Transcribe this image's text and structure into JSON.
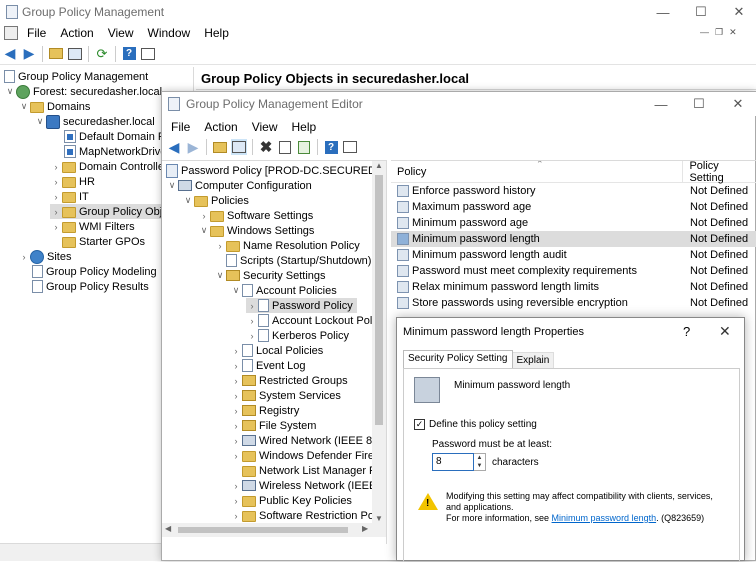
{
  "gpm": {
    "title": "Group Policy Management",
    "menu": [
      "File",
      "Action",
      "View",
      "Window",
      "Help"
    ],
    "tree": [
      {
        "label": "Group Policy Management",
        "icon": "gpm-icon"
      },
      {
        "label": "Forest: securedasher.local",
        "icon": "forest-icon"
      },
      {
        "label": "Domains",
        "icon": "folder-icon"
      },
      {
        "label": "securedasher.local",
        "icon": "domain-icon"
      },
      {
        "label": "Default Domain P",
        "icon": "gpo-link-icon"
      },
      {
        "label": "MapNetworkDrive",
        "icon": "gpo-link-icon"
      },
      {
        "label": "Domain Controlle",
        "icon": "folder-icon"
      },
      {
        "label": "HR",
        "icon": "folder-icon"
      },
      {
        "label": "IT",
        "icon": "folder-icon"
      },
      {
        "label": "Group Policy Obje",
        "icon": "folder-icon"
      },
      {
        "label": "WMI Filters",
        "icon": "folder-icon"
      },
      {
        "label": "Starter GPOs",
        "icon": "folder-icon"
      },
      {
        "label": "Sites",
        "icon": "sites-icon"
      },
      {
        "label": "Group Policy Modeling",
        "icon": "modeling-icon"
      },
      {
        "label": "Group Policy Results",
        "icon": "results-icon"
      }
    ],
    "header": "Group Policy Objects in securedasher.local",
    "colors": {
      "title_text": "#6d6d6d",
      "selection": "#dcdcdc"
    }
  },
  "gpme": {
    "title": "Group Policy Management Editor",
    "menu": [
      "File",
      "Action",
      "View",
      "Help"
    ],
    "tree": [
      {
        "label": "Password Policy [PROD-DC.SECUREDASHE"
      },
      {
        "label": "Computer Configuration"
      },
      {
        "label": "Policies"
      },
      {
        "label": "Software Settings"
      },
      {
        "label": "Windows Settings"
      },
      {
        "label": "Name Resolution Policy"
      },
      {
        "label": "Scripts (Startup/Shutdown)"
      },
      {
        "label": "Security Settings"
      },
      {
        "label": "Account Policies"
      },
      {
        "label": "Password Policy"
      },
      {
        "label": "Account Lockout Pol"
      },
      {
        "label": "Kerberos Policy"
      },
      {
        "label": "Local Policies"
      },
      {
        "label": "Event Log"
      },
      {
        "label": "Restricted Groups"
      },
      {
        "label": "System Services"
      },
      {
        "label": "Registry"
      },
      {
        "label": "File System"
      },
      {
        "label": "Wired Network (IEEE 802."
      },
      {
        "label": "Windows Defender Firew"
      },
      {
        "label": "Network List Manager Pc"
      },
      {
        "label": "Wireless Network (IEEE 80"
      },
      {
        "label": "Public Key Policies"
      },
      {
        "label": "Software Restriction Polic"
      }
    ],
    "columns": {
      "policy": "Policy",
      "setting": "Policy Setting"
    },
    "rows": [
      {
        "policy": "Enforce password history",
        "setting": "Not Defined"
      },
      {
        "policy": "Maximum password age",
        "setting": "Not Defined"
      },
      {
        "policy": "Minimum password age",
        "setting": "Not Defined"
      },
      {
        "policy": "Minimum password length",
        "setting": "Not Defined"
      },
      {
        "policy": "Minimum password length audit",
        "setting": "Not Defined"
      },
      {
        "policy": "Password must meet complexity requirements",
        "setting": "Not Defined"
      },
      {
        "policy": "Relax minimum password length limits",
        "setting": "Not Defined"
      },
      {
        "policy": "Store passwords using reversible encryption",
        "setting": "Not Defined"
      }
    ]
  },
  "dialog": {
    "title": "Minimum password length Properties",
    "help": "?",
    "tabs": [
      "Security Policy Setting",
      "Explain"
    ],
    "policy_name": "Minimum password length",
    "define_label": "Define this policy setting",
    "define_checked": true,
    "field_label": "Password must be at least:",
    "value": "8",
    "unit": "characters",
    "warning_line1": "Modifying this setting may affect compatibility with clients, services,",
    "warning_line2": "and applications.",
    "more_info_prefix": "For more information, see ",
    "more_info_link": "Minimum password length",
    "more_info_suffix": ". (Q823659)",
    "colors": {
      "link": "#0066cc",
      "warning": "#f2c400"
    }
  }
}
